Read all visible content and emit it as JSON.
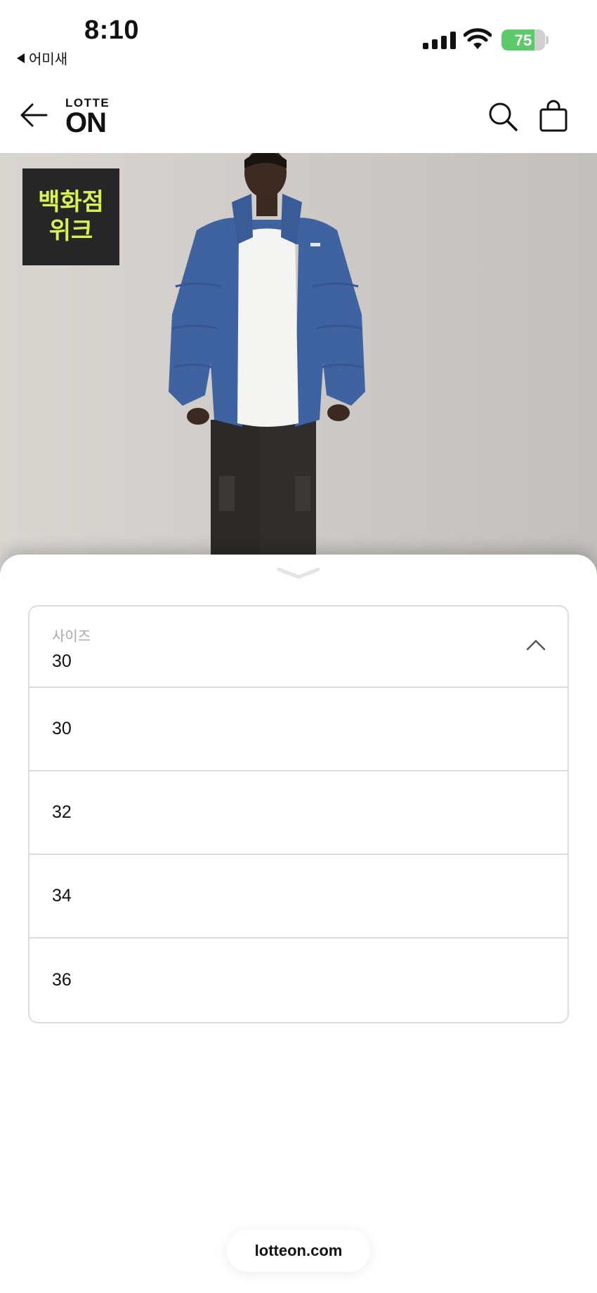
{
  "status_bar": {
    "time": "8:10",
    "back_app_label": "어미새",
    "battery_percent": "75",
    "battery_level": 0.75,
    "signal_icon": "cellular-signal-icon",
    "wifi_icon": "wifi-icon"
  },
  "header": {
    "back_icon": "arrow-left-icon",
    "logo_top": "LOTTE",
    "logo_bottom": "ON",
    "search_icon": "search-icon",
    "cart_icon": "shopping-bag-icon"
  },
  "product": {
    "badge_text": "백화점\n위크",
    "badge_color": "#d8f254"
  },
  "sheet": {
    "handle_icon": "chevron-down-icon",
    "select": {
      "label": "사이즈",
      "value": "30",
      "toggle_icon": "chevron-up-icon",
      "options": [
        "30",
        "32",
        "34",
        "36"
      ]
    }
  },
  "browser": {
    "url": "lotteon.com"
  }
}
